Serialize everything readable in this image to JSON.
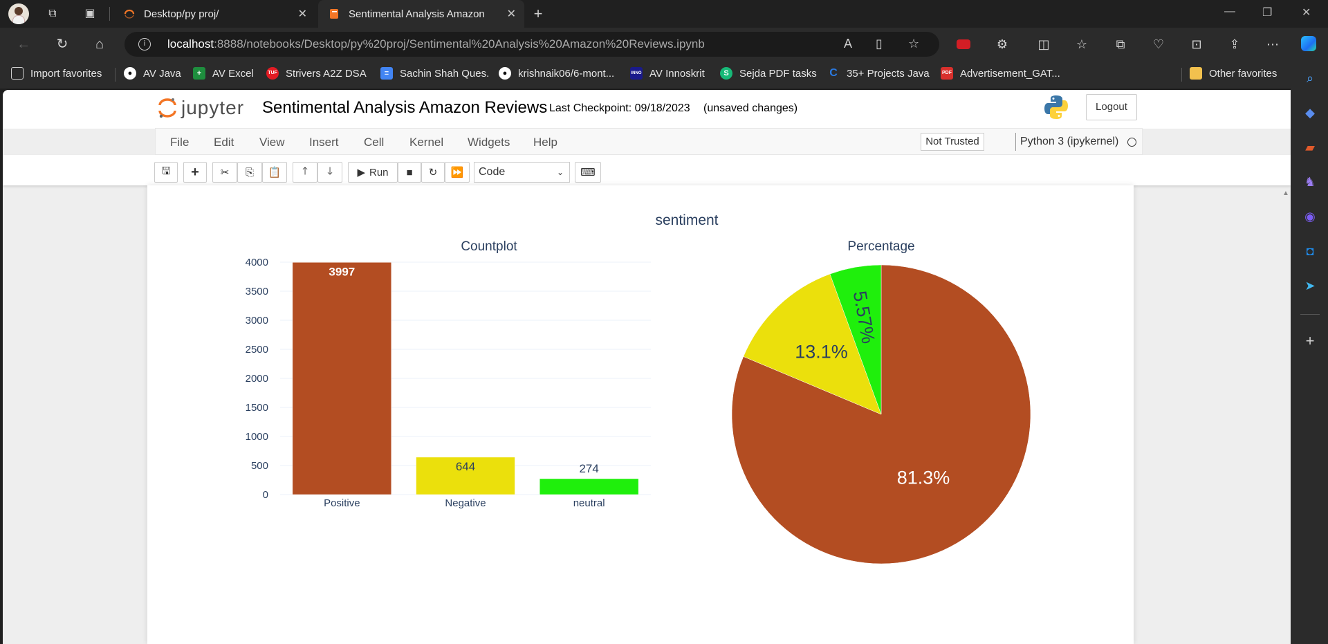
{
  "browser": {
    "tabs": [
      {
        "title": "Desktop/py proj/",
        "active": false
      },
      {
        "title": "Sentimental Analysis Amazon Re",
        "active": true
      }
    ],
    "url_host": "localhost",
    "url_path": ":8888/notebooks/Desktop/py%20proj/Sentimental%20Analysis%20Amazon%20Reviews.ipynb"
  },
  "bookmarks": [
    {
      "label": "Import favorites",
      "icon": "import-icon",
      "color": "#d0d0d0"
    },
    {
      "label": "AV Java",
      "icon": "github-icon",
      "color": "#ffffff"
    },
    {
      "label": "AV Excel",
      "icon": "sheets-icon",
      "color": "#1e8e3e"
    },
    {
      "label": "Strivers A2Z DSA",
      "icon": "tuf-icon",
      "color": "#e31b23"
    },
    {
      "label": "Sachin Shah Ques.",
      "icon": "docs-icon",
      "color": "#4285f4"
    },
    {
      "label": "krishnaik06/6-mont...",
      "icon": "github-icon",
      "color": "#ffffff"
    },
    {
      "label": "AV Innoskrit",
      "icon": "innoskrit-icon",
      "color": "#1a1a8c"
    },
    {
      "label": "Sejda PDF tasks",
      "icon": "sejda-icon",
      "color": "#17b978"
    },
    {
      "label": "35+ Projects Java",
      "icon": "c-icon",
      "color": "#2a7ae2"
    },
    {
      "label": "Advertisement_GAT...",
      "icon": "pdf-icon",
      "color": "#d9302c"
    }
  ],
  "other_favorites": "Other favorites",
  "jupyter": {
    "logo_text": "jupyter",
    "notebook_title": "Sentimental Analysis Amazon Reviews",
    "checkpoint": "Last Checkpoint: 09/18/2023",
    "unsaved": "(unsaved changes)",
    "logout": "Logout",
    "menus": [
      "File",
      "Edit",
      "View",
      "Insert",
      "Cell",
      "Kernel",
      "Widgets",
      "Help"
    ],
    "trust": "Not Trusted",
    "kernel": "Python 3 (ipykernel)",
    "run_label": "Run",
    "cell_type": "Code"
  },
  "chart_data": {
    "title": "sentiment",
    "subplots": [
      {
        "type": "bar",
        "title": "Countplot",
        "categories": [
          "Positive",
          "Negative",
          "neutral"
        ],
        "values": [
          3997,
          644,
          274
        ],
        "colors": [
          "#b34d22",
          "#ebe00c",
          "#1fef0c"
        ],
        "ylim": [
          0,
          4000
        ],
        "yticks": [
          0,
          500,
          1000,
          1500,
          2000,
          2500,
          3000,
          3500,
          4000
        ],
        "data_labels": [
          "3997",
          "644",
          "274"
        ]
      },
      {
        "type": "pie",
        "title": "Percentage",
        "labels": [
          "Positive",
          "Negative",
          "neutral"
        ],
        "values": [
          81.3,
          13.1,
          5.57
        ],
        "text": [
          "81.3%",
          "13.1%",
          "5.57%"
        ],
        "colors": [
          "#b34d22",
          "#ebe00c",
          "#1fef0c"
        ]
      }
    ]
  }
}
